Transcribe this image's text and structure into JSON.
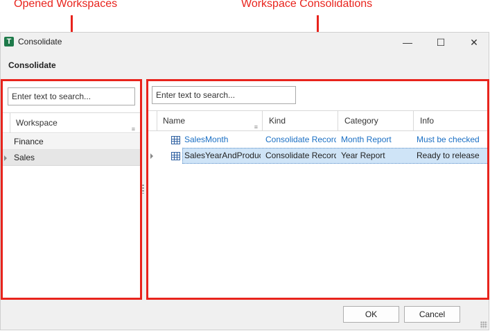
{
  "annotations": {
    "left_label": "Opened Workspaces",
    "right_label": "Workspace Consolidations"
  },
  "window": {
    "app_icon_letter": "T",
    "title": "Consolidate",
    "minimize": "—",
    "maximize": "☐",
    "close": "✕",
    "heading": "Consolidate"
  },
  "left_panel": {
    "search_placeholder": "Enter text to search...",
    "column_header": "Workspace",
    "rows": [
      "Finance",
      "Sales"
    ]
  },
  "right_panel": {
    "search_placeholder": "Enter text to search...",
    "columns": [
      "Name",
      "Kind",
      "Category",
      "Info"
    ],
    "rows": [
      {
        "name": "SalesMonth",
        "kind": "Consolidate Record",
        "category": "Month Report",
        "info": "Must be checked"
      },
      {
        "name": "SalesYearAndProduct",
        "kind": "Consolidate Record",
        "category": "Year Report",
        "info": "Ready to release"
      }
    ]
  },
  "buttons": {
    "ok": "OK",
    "cancel": "Cancel"
  },
  "colors": {
    "annotation_red": "#e8231c",
    "link_blue": "#1a6fc4",
    "selected_row": "#cfe4f7"
  }
}
